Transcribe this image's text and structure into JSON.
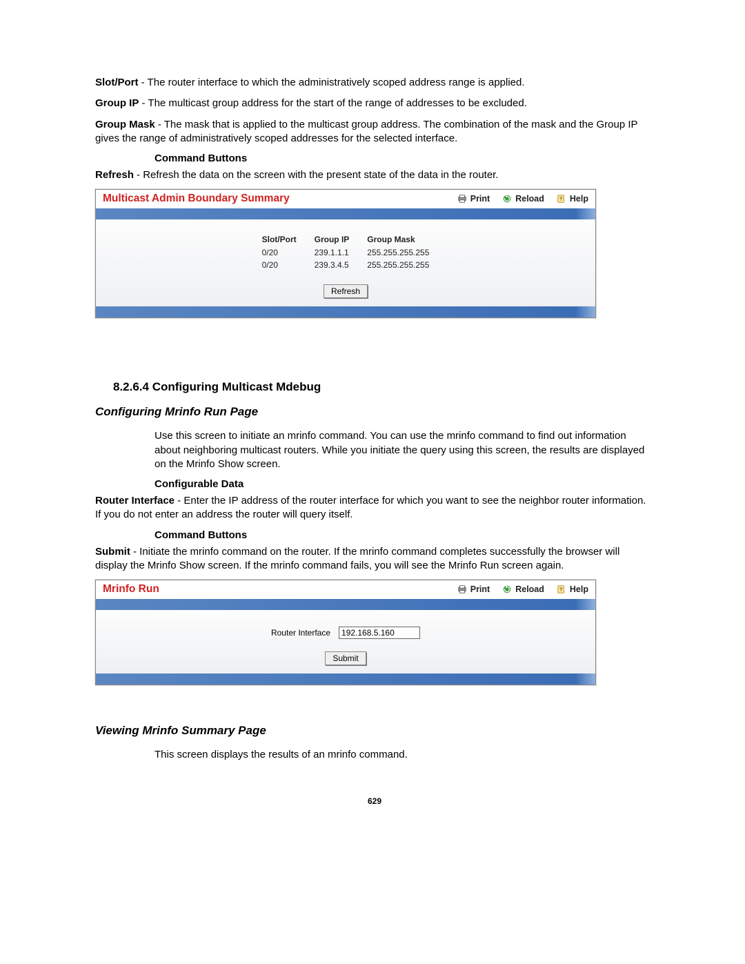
{
  "defs": {
    "slot_port": {
      "term": "Slot/Port",
      "desc": " - The router interface to which the administratively scoped address range is applied."
    },
    "group_ip": {
      "term": "Group IP",
      "desc": " - The multicast group address for the start of the range of addresses to be excluded."
    },
    "group_mask": {
      "term": "Group Mask",
      "desc": " - The mask that is applied to the multicast group address. The combination of the mask and the Group IP gives the range of administratively scoped addresses for the selected interface."
    },
    "command_buttons": "Command Buttons",
    "refresh": {
      "term": "Refresh",
      "desc": " - Refresh the data on the screen with the present state of the data in the router."
    }
  },
  "panel1": {
    "title": "Multicast Admin Boundary Summary",
    "actions": {
      "print": "Print",
      "reload": "Reload",
      "help": "Help"
    },
    "table": {
      "headers": [
        "Slot/Port",
        "Group IP",
        "Group Mask"
      ],
      "rows": [
        [
          "0/20",
          "239.1.1.1",
          "255.255.255.255"
        ],
        [
          "0/20",
          "239.3.4.5",
          "255.255.255.255"
        ]
      ]
    },
    "refresh_btn": "Refresh"
  },
  "section_heading": "8.2.6.4 Configuring Multicast Mdebug",
  "mrinfo_run": {
    "heading": "Configuring Mrinfo Run Page",
    "intro": "Use this screen to initiate an mrinfo command. You can use the mrinfo command to find out information about neighboring multicast routers. While you initiate the query using this screen, the results are displayed on the Mrinfo Show screen.",
    "configurable_data": "Configurable Data",
    "router_interface": {
      "term": "Router Interface",
      "desc": " - Enter the IP address of the router interface for which you want to see the neighbor router information. If you do not enter an address the router will query itself."
    },
    "command_buttons": "Command Buttons",
    "submit": {
      "term": "Submit",
      "desc": " - Initiate the mrinfo command on the router. If the mrinfo command completes successfully the browser will display the Mrinfo Show screen. If the mrinfo command fails, you will see the Mrinfo Run screen again."
    }
  },
  "panel2": {
    "title": "Mrinfo Run",
    "actions": {
      "print": "Print",
      "reload": "Reload",
      "help": "Help"
    },
    "label": "Router Interface",
    "value": "192.168.5.160",
    "submit_btn": "Submit"
  },
  "mrinfo_summary": {
    "heading": "Viewing Mrinfo Summary Page",
    "intro": "This screen displays the results of an mrinfo command."
  },
  "page_number": "629"
}
